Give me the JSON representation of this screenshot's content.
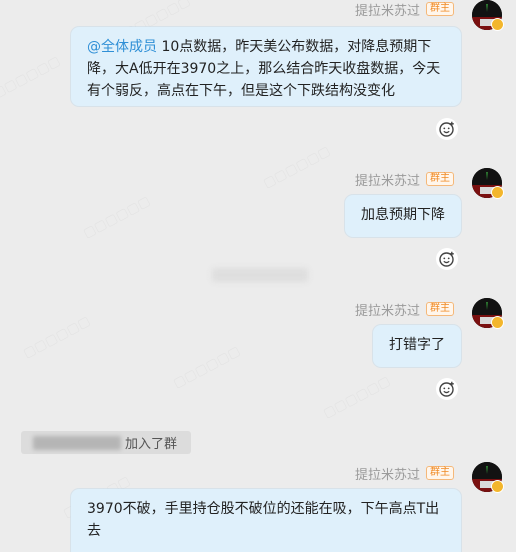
{
  "sender": {
    "name": "提拉米苏过",
    "role_badge": "群主"
  },
  "messages": [
    {
      "mention": "@全体成员",
      "text": " 10点数据，昨天美公布数据，对降息预期下降，大A低开在3970之上，那么结合昨天收盘数据，今天有个弱反，高点在下午，但是这个下跌结构没变化"
    },
    {
      "text": "加息预期下降"
    },
    {
      "text": "打错字了"
    },
    {
      "text": "3970不破，手里持仓股不破位的还能在吸，下午高点T出去"
    }
  ],
  "system_notice": {
    "suffix": "加入了群"
  },
  "icons": {
    "reaction": "emoji-react-icon",
    "avatar": "group-owner-avatar",
    "badge": "crown-badge-icon"
  },
  "colors": {
    "bubble_bg": "#dff0fb",
    "mention": "#2f8fd6",
    "badge": "#f08a24",
    "page_bg": "#ececec"
  }
}
